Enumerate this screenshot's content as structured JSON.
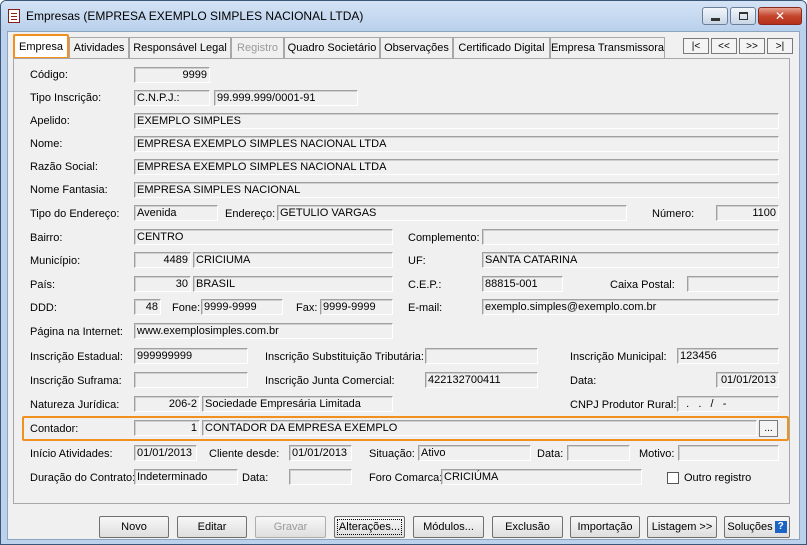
{
  "window": {
    "title": "Empresas (EMPRESA EXEMPLO SIMPLES NACIONAL LTDA)",
    "close_glyph": "✕"
  },
  "tabs": [
    {
      "label": "Empresa"
    },
    {
      "label": "Atividades"
    },
    {
      "label": "Responsável Legal"
    },
    {
      "label": "Registro"
    },
    {
      "label": "Quadro Societário"
    },
    {
      "label": "Observações"
    },
    {
      "label": "Certificado Digital"
    },
    {
      "label": "Empresa Transmissora"
    }
  ],
  "record_nav": [
    "|<",
    "<<",
    ">>",
    ">|"
  ],
  "form": {
    "codigo": {
      "label": "Código:",
      "value": "9999"
    },
    "tipo_inscricao": {
      "label": "Tipo Inscrição:",
      "type": "C.N.P.J.:",
      "value": "99.999.999/0001-91"
    },
    "apelido": {
      "label": "Apelido:",
      "value": "EXEMPLO SIMPLES"
    },
    "nome": {
      "label": "Nome:",
      "value": "EMPRESA EXEMPLO SIMPLES NACIONAL LTDA"
    },
    "razao_social": {
      "label": "Razão Social:",
      "value": "EMPRESA EXEMPLO SIMPLES NACIONAL LTDA"
    },
    "nome_fantasia": {
      "label": "Nome Fantasia:",
      "value": "EMPRESA SIMPLES NACIONAL"
    },
    "tipo_endereco": {
      "label": "Tipo do Endereço:",
      "value": "Avenida"
    },
    "endereco": {
      "label": "Endereço:",
      "value": "GETULIO VARGAS"
    },
    "numero": {
      "label": "Número:",
      "value": "1100"
    },
    "bairro": {
      "label": "Bairro:",
      "value": "CENTRO"
    },
    "complemento": {
      "label": "Complemento:",
      "value": ""
    },
    "municipio": {
      "label": "Município:",
      "code": "4489",
      "value": "CRICIUMA"
    },
    "uf": {
      "label": "UF:",
      "value": "SANTA CATARINA"
    },
    "pais": {
      "label": "País:",
      "code": "30",
      "value": "BRASIL"
    },
    "cep": {
      "label": "C.E.P.:",
      "value": "88815-001"
    },
    "caixa_postal": {
      "label": "Caixa Postal:",
      "value": ""
    },
    "ddd": {
      "label": "DDD:",
      "value": "48"
    },
    "fone": {
      "label": "Fone:",
      "value": "9999-9999"
    },
    "fax": {
      "label": "Fax:",
      "value": "9999-9999"
    },
    "email": {
      "label": "E-mail:",
      "value": "exemplo.simples@exemplo.com.br"
    },
    "pagina": {
      "label": "Página na Internet:",
      "value": "www.exemplosimples.com.br"
    },
    "insc_estadual": {
      "label": "Inscrição Estadual:",
      "value": "999999999"
    },
    "insc_subst": {
      "label": "Inscrição Substituição Tributária:",
      "value": ""
    },
    "insc_municipal": {
      "label": "Inscrição Municipal:",
      "value": "123456"
    },
    "insc_suframa": {
      "label": "Inscrição Suframa:",
      "value": ""
    },
    "insc_junta": {
      "label": "Inscrição Junta Comercial:",
      "value": "422132700411"
    },
    "data": {
      "label": "Data:",
      "value": "01/01/2013"
    },
    "natureza": {
      "label": "Natureza Jurídica:",
      "code": "206-2",
      "value": "Sociedade Empresária Limitada"
    },
    "cnpj_produtor": {
      "label": "CNPJ Produtor Rural:",
      "value": "  .   .   /   -"
    },
    "contador": {
      "label": "Contador:",
      "code": "1",
      "value": "CONTADOR DA EMPRESA EXEMPLO",
      "button": "..."
    },
    "inicio_atividades": {
      "label": "Início Atividades:",
      "value": "01/01/2013"
    },
    "cliente_desde": {
      "label": "Cliente desde:",
      "value": "01/01/2013"
    },
    "situacao": {
      "label": "Situação:",
      "value": "Ativo"
    },
    "data_situacao": {
      "label": "Data:",
      "value": ""
    },
    "motivo": {
      "label": "Motivo:",
      "value": ""
    },
    "duracao": {
      "label": "Duração do Contrato:",
      "value": "Indeterminado"
    },
    "data_contrato": {
      "label": "Data:",
      "value": ""
    },
    "foro": {
      "label": "Foro Comarca:",
      "value": "CRICIÚMA"
    },
    "outro_registro": {
      "label": "Outro registro",
      "checked": false
    }
  },
  "buttons": {
    "novo": "Novo",
    "editar": "Editar",
    "gravar": "Gravar",
    "alteracoes": "Alterações...",
    "modulos": "Módulos...",
    "exclusao": "Exclusão",
    "importacao": "Importação",
    "listagem": "Listagem >>",
    "solucoes": "Soluções",
    "help_glyph": "?"
  },
  "colors": {
    "highlight": "#f0901e",
    "title_bar": "#bcd2ec"
  }
}
